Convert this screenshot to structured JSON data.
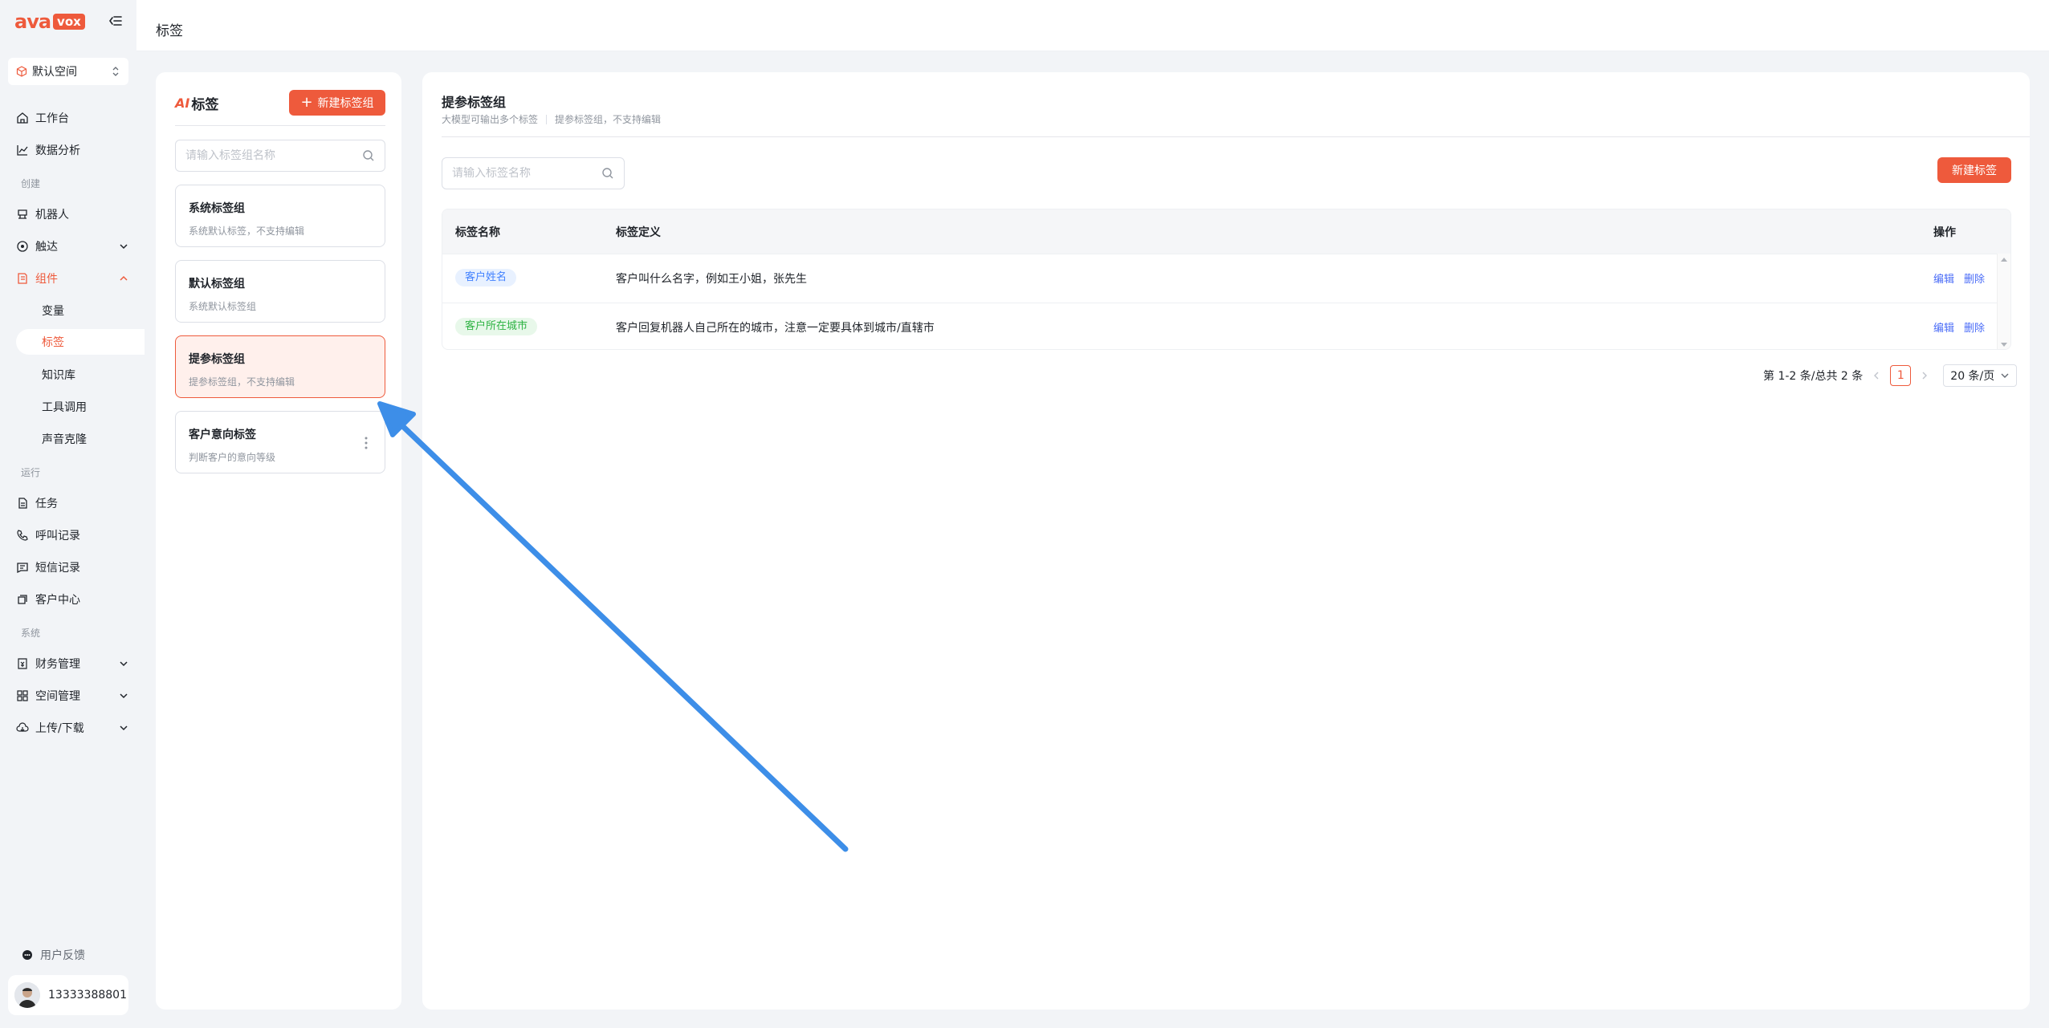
{
  "sidebar": {
    "logo_main": "ava",
    "logo_tag": "vox",
    "space": "默认空间",
    "items": [
      {
        "label": "工作台"
      },
      {
        "label": "数据分析"
      },
      {
        "label": "机器人"
      },
      {
        "label": "触达"
      },
      {
        "label": "组件"
      },
      {
        "label": "任务"
      },
      {
        "label": "呼叫记录"
      },
      {
        "label": "短信记录"
      },
      {
        "label": "客户中心"
      },
      {
        "label": "财务管理"
      },
      {
        "label": "空间管理"
      },
      {
        "label": "上传/下载"
      }
    ],
    "sections": [
      "创建",
      "运行",
      "系统"
    ],
    "sub_items": [
      "变量",
      "标签",
      "知识库",
      "工具调用",
      "声音克隆"
    ],
    "feedback": "用户反馈",
    "user": "13333388801"
  },
  "header": {
    "title": "标签"
  },
  "group_panel": {
    "ai_logo": "AI",
    "title": "标签",
    "new_button": "新建标签组",
    "search_placeholder": "请输入标签组名称",
    "groups": [
      {
        "name": "系统标签组",
        "desc": "系统默认标签，不支持编辑"
      },
      {
        "name": "默认标签组",
        "desc": "系统默认标签组"
      },
      {
        "name": "提参标签组",
        "desc": "提参标签组，不支持编辑"
      },
      {
        "name": "客户意向标签",
        "desc": "判断客户的意向等级"
      }
    ]
  },
  "main": {
    "title": "提参标签组",
    "sub1": "大模型可输出多个标签",
    "sub2": "提参标签组，不支持编辑",
    "search_placeholder": "请输入标签名称",
    "new_button": "新建标签",
    "columns": {
      "name": "标签名称",
      "definition": "标签定义",
      "actions": "操作"
    },
    "rows": [
      {
        "tag": "客户姓名",
        "definition": "客户叫什么名字，例如王小姐，张先生",
        "edit": "编辑",
        "delete": "删除"
      },
      {
        "tag": "客户所在城市",
        "definition": "客户回复机器人自己所在的城市，注意一定要具体到城市/直辖市",
        "edit": "编辑",
        "delete": "删除"
      }
    ],
    "pagination": {
      "summary": "第 1-2 条/总共 2 条",
      "current": "1",
      "page_size": "20 条/页"
    }
  },
  "colors": {
    "brand": "#ee5a3c",
    "link": "#4a6cf7",
    "annotation_arrow": "#3d8ee8"
  }
}
